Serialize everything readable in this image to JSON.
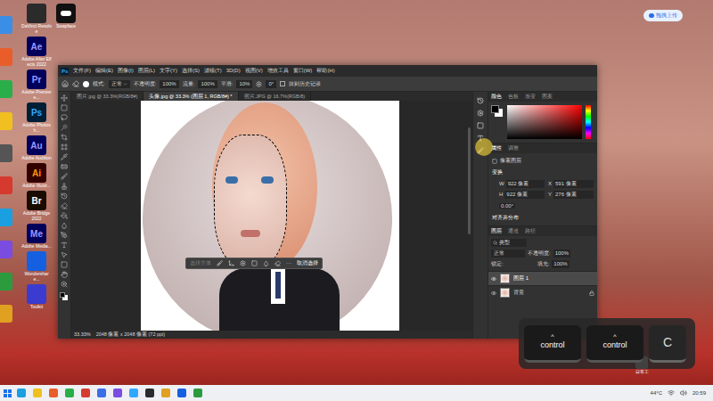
{
  "desktop": {
    "upload_button": "拖拽上传",
    "left_column": [
      {
        "color": "#3a8ee6"
      },
      {
        "color": "#e85d2a"
      },
      {
        "color": "#2aae4a"
      },
      {
        "color": "#f0c020"
      },
      {
        "color": "#555555"
      },
      {
        "color": "#d63a2f"
      },
      {
        "color": "#1aa0e0"
      },
      {
        "color": "#7b4ce0"
      },
      {
        "color": "#2b9b3e"
      },
      {
        "color": "#e0a020"
      }
    ],
    "icons": [
      {
        "glyph": "",
        "label": "DaVinci Resolve",
        "color": "#2b2b2b",
        "text_color": "#ffffff"
      },
      {
        "glyph": "Ae",
        "label": "Adobe After Effects 2022",
        "color": "#00005b",
        "text_color": "#9999ff"
      },
      {
        "glyph": "Pr",
        "label": "Adobe Premiere...",
        "color": "#00005b",
        "text_color": "#9999ff"
      },
      {
        "glyph": "Ps",
        "label": "Adobe Photosh...",
        "color": "#001e36",
        "text_color": "#31a8ff"
      },
      {
        "glyph": "Au",
        "label": "Adobe Audition",
        "color": "#00005b",
        "text_color": "#9999ff"
      },
      {
        "glyph": "Ai",
        "label": "Adobe Illustr...",
        "color": "#330000",
        "text_color": "#ff9a00"
      },
      {
        "glyph": "Br",
        "label": "Adobe Bridge 2022",
        "color": "#1a0b00",
        "text_color": "#ffffff"
      },
      {
        "glyph": "Me",
        "label": "Adobe Media...",
        "color": "#00005b",
        "text_color": "#9999ff"
      },
      {
        "glyph": "",
        "label": "Wondershare...",
        "color": "#1460e0",
        "text_color": "#ffffff"
      },
      {
        "glyph": "",
        "label": "Toolkit",
        "color": "#3b3bd0",
        "text_color": "#ffffff"
      }
    ],
    "top_icon": {
      "label": "Swapface"
    },
    "corner_icon": {
      "label": "日常工"
    }
  },
  "photoshop": {
    "logo": "Ps",
    "menu": [
      "文件(F)",
      "编辑(E)",
      "图像(I)",
      "图层(L)",
      "文字(Y)",
      "选择(S)",
      "滤镜(T)",
      "3D(D)",
      "视图(V)",
      "增效工具",
      "窗口(W)",
      "帮助(H)"
    ],
    "options": {
      "mode_label": "模式:",
      "mode": "正常",
      "opacity_label": "不透明度:",
      "opacity": "100%",
      "flow_label": "流量:",
      "flow": "100%",
      "smooth_label": "平滑:",
      "smooth": "10%",
      "angle": "0°",
      "history_label": "抹到历史记录",
      "history_checked": false
    },
    "tabs": [
      {
        "label": "图片.jpg @ 33.3%(RGB/8#)",
        "selected": false
      },
      {
        "label": "头像.jpg @ 33.3% (图层 1, RGB/8#) *",
        "selected": true
      },
      {
        "label": "照片.JPG @ 16.7%(RGB/8)",
        "selected": false
      }
    ],
    "context_bar": {
      "subject": "选择主体",
      "subject_disabled": true,
      "more": "···",
      "deselect": "取消选择"
    },
    "status": {
      "zoom": "33.33%",
      "size": "2048 像素 x 2048 像素 (72 ppi)"
    },
    "color_panel": {
      "tabs": [
        {
          "label": "颜色",
          "selected": true
        },
        {
          "label": "色板",
          "selected": false
        },
        {
          "label": "渐变",
          "selected": false
        },
        {
          "label": "图案",
          "selected": false
        }
      ]
    },
    "properties": {
      "tabs": [
        {
          "label": "属性",
          "selected": true
        },
        {
          "label": "调整",
          "selected": false
        }
      ],
      "layer_kind": "像素图层",
      "section": "变换",
      "fields": [
        {
          "label": "W",
          "value": "922 像素"
        },
        {
          "label": "X",
          "value": "591 像素"
        },
        {
          "label": "H",
          "value": "922 像素"
        },
        {
          "label": "Y",
          "value": "276 像素"
        }
      ],
      "angle": "0.00°",
      "align": "对齐并分布"
    },
    "layers": {
      "tabs": [
        {
          "label": "图层",
          "selected": true
        },
        {
          "label": "通道",
          "selected": false
        },
        {
          "label": "路径",
          "selected": false
        }
      ],
      "filter": "类型",
      "blend": "正常",
      "opacity_label": "不透明度:",
      "opacity": "100%",
      "lock_label": "锁定:",
      "fill_label": "填充:",
      "fill": "100%",
      "rows": [
        {
          "name": "图层 1",
          "selected": true,
          "visible": true,
          "locked": false
        },
        {
          "name": "背景",
          "selected": false,
          "visible": true,
          "locked": true
        }
      ]
    }
  },
  "key_overlay": {
    "keys": [
      {
        "label": "control",
        "caret": "^",
        "pressed": true
      },
      {
        "label": "control",
        "caret": "^",
        "pressed": true
      },
      {
        "label": "C",
        "caret": "",
        "pressed": false
      }
    ]
  },
  "taskbar": {
    "apps": [
      {
        "color": "#1aa0e0"
      },
      {
        "color": "#f0c020"
      },
      {
        "color": "#e85d2a"
      },
      {
        "color": "#2aae4a"
      },
      {
        "color": "#d63a2f"
      },
      {
        "color": "#3a6ee6"
      },
      {
        "color": "#7b4ce0"
      },
      {
        "color": "#31a8ff"
      },
      {
        "color": "#2b2b2b"
      },
      {
        "color": "#e0a020"
      },
      {
        "color": "#1460e0"
      },
      {
        "color": "#2b9b3e"
      }
    ],
    "temperature": "44°C",
    "time": "20:59"
  }
}
